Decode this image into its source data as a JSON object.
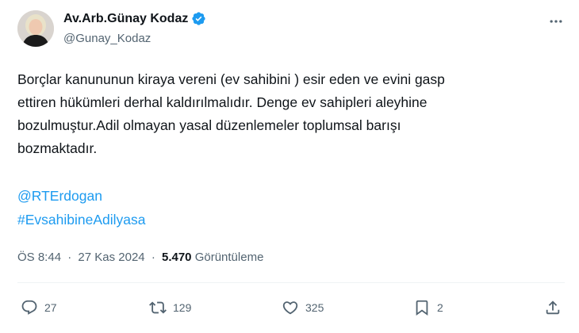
{
  "author": {
    "display_name": "Av.Arb.Günay Kodaz",
    "handle": "@Gunay_Kodaz",
    "verified": true
  },
  "tweet": {
    "lines": [
      "Borçlar kanununun kiraya vereni (ev sahibini ) esir eden ve evini gasp",
      "ettiren hükümleri derhal kaldırılmalıdır. Denge ev sahipleri aleyhine",
      "bozulmuştur.Adil olmayan yasal düzenlemeler toplumsal barışı",
      "bozmaktadır."
    ],
    "mention": "@RTErdogan",
    "hashtag": "#EvsahibineAdilyasa"
  },
  "meta": {
    "time": "ÖS 8:44",
    "separator": "·",
    "date": "27 Kas 2024",
    "views_count": "5.470",
    "views_label": "Görüntüleme"
  },
  "actions": {
    "replies": "27",
    "retweets": "129",
    "likes": "325",
    "bookmarks": "2"
  },
  "colors": {
    "accent": "#1d9bf0",
    "text": "#0f1419",
    "muted": "#536471"
  },
  "icons": [
    "verified-badge-icon",
    "more-icon",
    "reply-icon",
    "retweet-icon",
    "like-icon",
    "bookmark-icon",
    "share-icon"
  ]
}
